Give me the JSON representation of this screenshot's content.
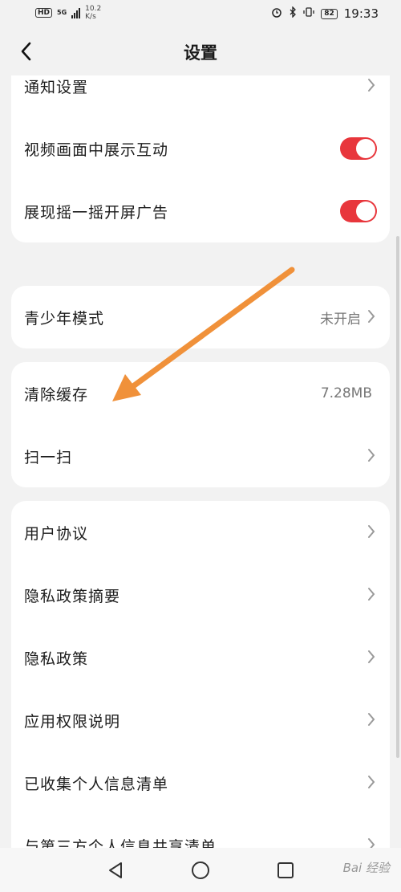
{
  "status_bar": {
    "hd": "HD",
    "network": "5G",
    "speed_top": "10.2",
    "speed_bottom": "K/s",
    "battery": "82",
    "time": "19:33"
  },
  "header": {
    "title": "设置"
  },
  "group1": [
    {
      "label": "通知设置"
    },
    {
      "label": "视频画面中展示互动",
      "toggle": true
    },
    {
      "label": "展现摇一摇开屏广告",
      "toggle": true
    }
  ],
  "group2": [
    {
      "label": "青少年模式",
      "value": "未开启"
    }
  ],
  "group3": [
    {
      "label": "清除缓存",
      "value": "7.28MB"
    },
    {
      "label": "扫一扫"
    }
  ],
  "group4": [
    {
      "label": "用户协议"
    },
    {
      "label": "隐私政策摘要"
    },
    {
      "label": "隐私政策"
    },
    {
      "label": "应用权限说明"
    },
    {
      "label": "已收集个人信息清单"
    },
    {
      "label": "与第三方个人信息共享清单"
    }
  ],
  "watermark": "Bai 经验",
  "colors": {
    "toggle_on": "#e8363c",
    "annotation_arrow": "#f0913a"
  }
}
